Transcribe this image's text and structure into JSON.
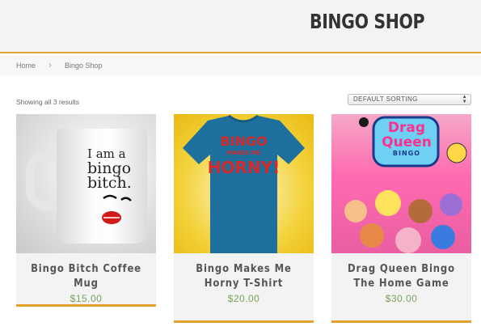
{
  "header": {
    "title": "BINGO SHOP"
  },
  "breadcrumb": {
    "home": "Home",
    "separator": "›",
    "current": "Bingo Shop"
  },
  "shop": {
    "result_count": "Showing all 3 results",
    "sorting": {
      "selected": "DEFAULT SORTING"
    }
  },
  "products": [
    {
      "title": "Bingo Bitch Coffee Mug",
      "price": "$15.00",
      "image_text": [
        "I am a",
        "bingo",
        "bitch."
      ]
    },
    {
      "title": "Bingo Makes Me Horny T-Shirt",
      "price": "$20.00",
      "image_text": [
        "BINGO",
        "MAKES ME",
        "HORNY!"
      ]
    },
    {
      "title": "Drag Queen Bingo The Home Game",
      "price": "$30.00",
      "image_text": [
        "Drag",
        "Queen",
        "BINGO"
      ]
    }
  ],
  "colors": {
    "accent": "#e3a02c",
    "price": "#7aa25a",
    "header_bg": "#f3f3f3"
  }
}
